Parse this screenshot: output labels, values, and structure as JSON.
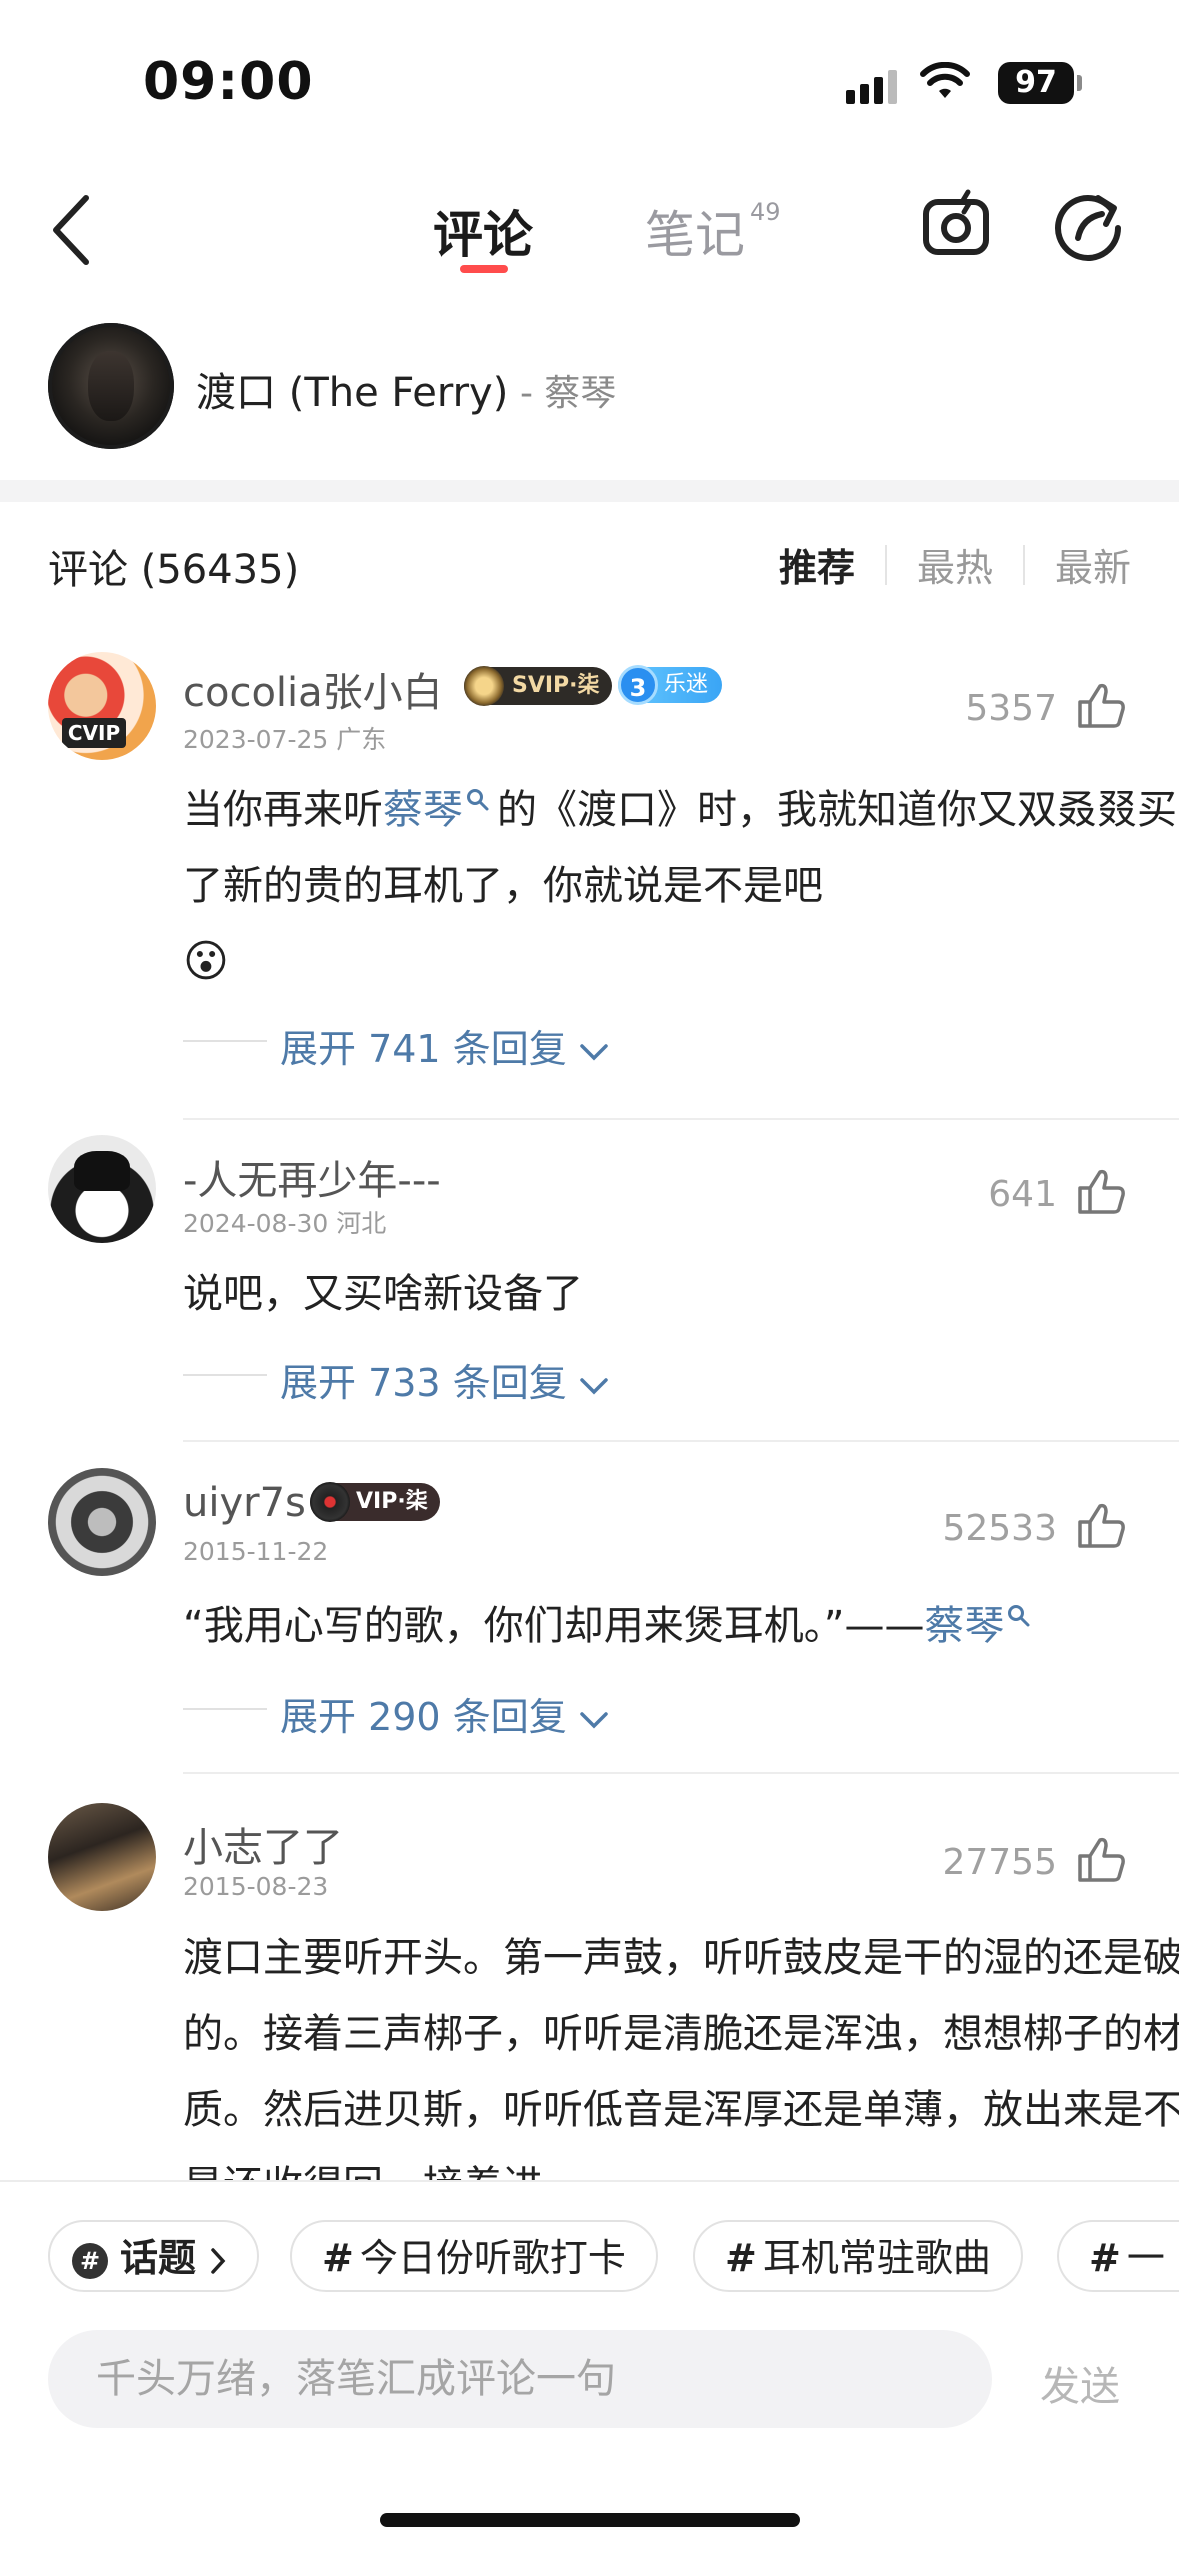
{
  "status_bar": {
    "time": "09:00",
    "battery": "97"
  },
  "header": {
    "tab_comments": "评论",
    "tab_notes": "笔记",
    "notes_count": "49"
  },
  "song": {
    "title": "渡口 (The Ferry)",
    "artist": "- 蔡琴"
  },
  "comments_header": {
    "count_label": "评论 (56435)",
    "sort": [
      "推荐",
      "最热",
      "最新"
    ]
  },
  "comments": [
    {
      "user": "cocolia张小白",
      "badge1": "SVIP·柒",
      "badge2_num": "3",
      "badge2": "乐迷",
      "meta": "2023-07-25 广东",
      "likes": "5357",
      "text_a": "当你再来听",
      "text_link": "蔡琴",
      "text_b": "的《渡口》时，我就知道你又双叒叕买了新的贵的耳机了，你就说是不是吧",
      "emoji": "😮",
      "expand": "展开 741 条回复"
    },
    {
      "user": "-人无再少年---",
      "meta": "2024-08-30 河北",
      "likes": "641",
      "text": "说吧，又买啥新设备了",
      "expand": "展开 733 条回复"
    },
    {
      "user": "uiyr7s",
      "badge1": "VIP·柒",
      "meta": "2015-11-22",
      "likes": "52533",
      "text_a": "“我用心写的歌，你们却用来煲耳机。”——",
      "text_link": "蔡琴",
      "expand": "展开 290 条回复"
    },
    {
      "user": "小志了了",
      "meta": "2015-08-23",
      "likes": "27755",
      "text": "渡口主要听开头。第一声鼓，听听鼓皮是干的湿的还是破的。接着三声梆子，听听是清脆还是浑浊，想想梆子的材质。然后进贝斯，听听低音是浑厚还是单薄，放出来是不是还收得回，接着进"
    }
  ],
  "topics": {
    "topic_label": "话题",
    "chips": [
      "今日份听歌打卡",
      "耳机常驻歌曲",
      "一"
    ]
  },
  "composer": {
    "placeholder": "千头万绪，落笔汇成评论一句",
    "send": "发送"
  }
}
